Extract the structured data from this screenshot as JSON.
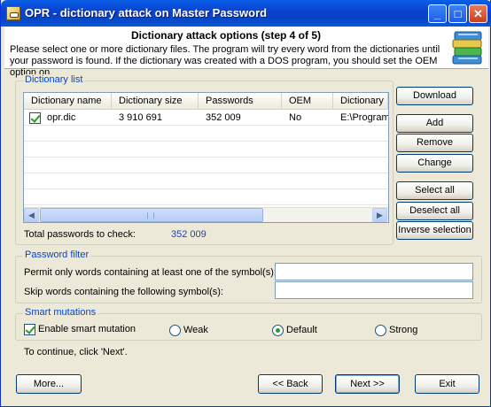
{
  "window": {
    "title": "OPR - dictionary attack on Master Password",
    "minimize_glyph": "_",
    "maximize_glyph": "□",
    "close_glyph": "✕"
  },
  "header": {
    "step_title": "Dictionary attack options (step 4 of 5)",
    "instructions": "Please select one or more dictionary files. The program will try every word from the dictionaries until your password is found. If the dictionary was created with a DOS program, you should set the OEM option on."
  },
  "dictionary_list": {
    "group_label": "Dictionary list",
    "columns": [
      "Dictionary name",
      "Dictionary size",
      "Passwords",
      "OEM",
      "Dictionary"
    ],
    "rows": [
      {
        "checked": true,
        "name": "opr.dic",
        "size": "3 910 691",
        "passwords": "352 009",
        "oem": "No",
        "path": "E:\\Program"
      }
    ],
    "total_label": "Total passwords to check:",
    "total_value": "352 009",
    "scroll_left_glyph": "◀",
    "scroll_right_glyph": "▶"
  },
  "side_buttons": {
    "download": "Download",
    "add": "Add",
    "remove": "Remove",
    "change": "Change",
    "select_all": "Select all",
    "deselect_all": "Deselect all",
    "inverse_selection": "Inverse selection"
  },
  "password_filter": {
    "group_label": "Password filter",
    "permit_label": "Permit only  words containing at least one of the symbol(s):",
    "permit_value": "",
    "skip_label": "Skip words containing the following symbol(s):",
    "skip_value": ""
  },
  "smart_mutations": {
    "group_label": "Smart mutations",
    "enable_label": "Enable smart mutation",
    "enable_checked": true,
    "options": [
      "Weak",
      "Default",
      "Strong"
    ],
    "selected": "Default"
  },
  "footer": {
    "continue_text": "To continue, click 'Next'.",
    "more": "More...",
    "back": "<< Back",
    "next": "Next >>",
    "exit": "Exit"
  }
}
